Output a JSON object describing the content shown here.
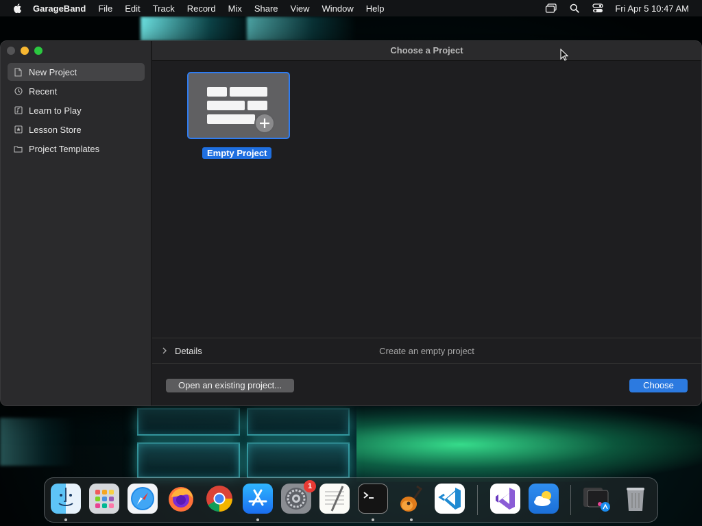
{
  "menubar": {
    "app_name": "GarageBand",
    "menus": [
      "File",
      "Edit",
      "Track",
      "Record",
      "Mix",
      "Share",
      "View",
      "Window",
      "Help"
    ],
    "clock": "Fri Apr 5  10:47 AM",
    "status_icons": [
      "screen-mirroring-icon",
      "spotlight-search-icon",
      "control-center-icon"
    ]
  },
  "window": {
    "title": "Choose a Project",
    "sidebar": {
      "items": [
        {
          "label": "New Project",
          "icon": "document-icon",
          "selected": true
        },
        {
          "label": "Recent",
          "icon": "clock-icon"
        },
        {
          "label": "Learn to Play",
          "icon": "music-note-icon"
        },
        {
          "label": "Lesson Store",
          "icon": "star-icon"
        },
        {
          "label": "Project Templates",
          "icon": "folder-icon"
        }
      ]
    },
    "project_tile": {
      "label": "Empty Project",
      "icon": "empty-project-plus-icon"
    },
    "details": {
      "label": "Details",
      "description": "Create an empty project"
    },
    "buttons": {
      "open_existing": "Open an existing project...",
      "choose": "Choose"
    }
  },
  "dock": {
    "apps": [
      "Finder",
      "Launchpad",
      "Safari",
      "Firefox",
      "Chrome",
      "App Store",
      "System Settings",
      "TextEdit",
      "Terminal",
      "GarageBand",
      "Visual Studio Code",
      "Visual Studio",
      "Weather",
      "App Store Utility",
      "Trash"
    ],
    "system_settings_badge": "1"
  },
  "colors": {
    "accent": "#2c7ae0",
    "selection": "#1f6fe0",
    "window_bg": "#1e1e20",
    "sidebar_bg": "#2a2a2c"
  }
}
